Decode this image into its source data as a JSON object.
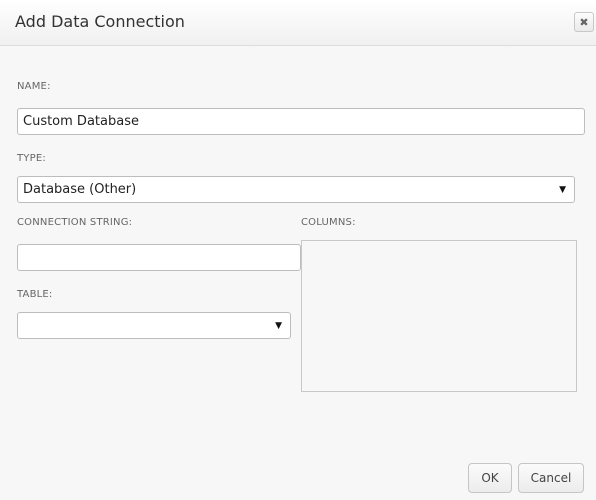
{
  "dialog": {
    "title": "Add Data Connection",
    "close_icon": "close-icon"
  },
  "fields": {
    "name_label": "NAME:",
    "name_value": "Custom Database",
    "type_label": "TYPE:",
    "type_value": "Database (Other)",
    "connection_string_label": "CONNECTION STRING:",
    "connection_string_value": "",
    "table_label": "TABLE:",
    "table_value": "",
    "columns_label": "COLUMNS:"
  },
  "icons": {
    "close": "✖",
    "dropdown": "▼"
  },
  "buttons": {
    "ok": "OK",
    "cancel": "Cancel"
  }
}
